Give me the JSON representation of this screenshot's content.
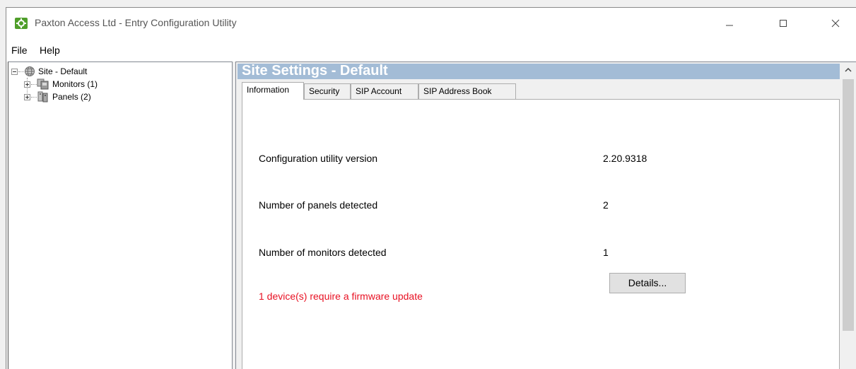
{
  "window": {
    "title": "Paxton Access Ltd - Entry Configuration Utility",
    "controls": [
      "minimize-icon",
      "maximize-icon",
      "close-icon"
    ],
    "app_icon": "paxton-gear-icon",
    "accent_color": "#4f9e2a"
  },
  "menu": {
    "file": "File",
    "help": "Help"
  },
  "tree": {
    "root": {
      "label": "Site - Default",
      "icon": "globe-icon",
      "expanded": true
    },
    "children": [
      {
        "label": "Monitors (1)",
        "icon": "monitors-icon",
        "expanded": false
      },
      {
        "label": "Panels (2)",
        "icon": "panels-icon",
        "expanded": false
      }
    ]
  },
  "content": {
    "header_title": "Site Settings - Default",
    "header_color": "#a3bcd6",
    "tabs": [
      {
        "label": "Information",
        "active": true
      },
      {
        "label": "Security",
        "active": false
      },
      {
        "label": "SIP Account",
        "active": false
      },
      {
        "label": "SIP Address Book",
        "active": false
      }
    ],
    "info": {
      "version_label": "Configuration utility version",
      "version_value": "2.20.9318",
      "panels_label": "Number of panels detected",
      "panels_value": "2",
      "monitors_label": "Number of monitors detected",
      "monitors_value": "1",
      "firmware_warning": "1 device(s) require a firmware update",
      "warning_color": "#e81123",
      "details_button": "Details..."
    }
  }
}
